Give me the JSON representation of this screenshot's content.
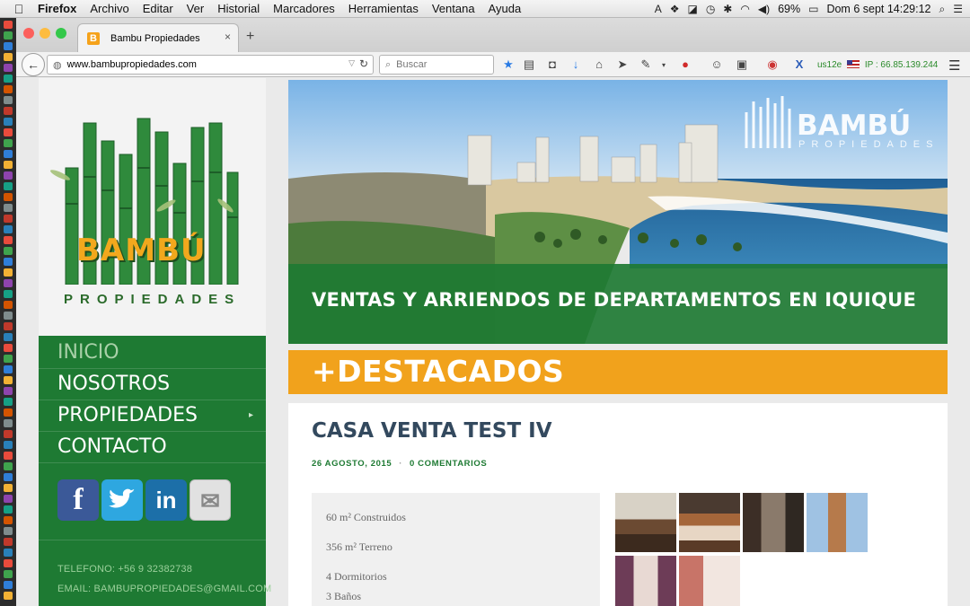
{
  "menubar": {
    "apple_icon": "apple-icon",
    "app": "Firefox",
    "items": [
      "Archivo",
      "Editar",
      "Ver",
      "Historial",
      "Marcadores",
      "Herramientas",
      "Ventana",
      "Ayuda"
    ],
    "battery": "69%",
    "datetime": "Dom 6 sept  14:29:12"
  },
  "browser": {
    "tab_title": "Bambu Propiedades",
    "tab_favicon": "B",
    "url": "www.bambupropiedades.com",
    "search_placeholder": "Buscar",
    "ext_user": "us12e",
    "ext_ip": "IP : 66.85.139.244"
  },
  "sidebar": {
    "logo_name": "BAMBÚ",
    "logo_sub": "PROPIEDADES",
    "nav": [
      {
        "label": "INICIO",
        "active": true
      },
      {
        "label": "NOSOTROS"
      },
      {
        "label": "PROPIEDADES",
        "has_submenu": true
      },
      {
        "label": "CONTACTO"
      }
    ],
    "social": [
      {
        "icon": "facebook-icon",
        "glyph": "f",
        "color": "#3b5998"
      },
      {
        "icon": "twitter-icon",
        "glyph": "t",
        "color": "#2ea7e0"
      },
      {
        "icon": "linkedin-icon",
        "glyph": "in",
        "color": "#1c6fa8"
      },
      {
        "icon": "mail-icon",
        "glyph": "✉",
        "color": "#d5d5d5"
      }
    ],
    "phone": "TELEFONO: +56 9 32382738",
    "email": "EMAIL: BAMBUPROPIEDADES@GMAIL.COM"
  },
  "banner": {
    "brand": "BAMBÚ",
    "brand_sub": "PROPIEDADES",
    "tagline": "VENTAS Y ARRIENDOS DE DEPARTAMENTOS EN IQUIQUE"
  },
  "featured": {
    "heading": "+DESTACADOS",
    "post": {
      "title": "CASA VENTA TEST IV",
      "date": "26 AGOSTO, 2015",
      "comments": "0 COMENTARIOS",
      "specs": [
        "60 m² Construidos",
        "356 m² Terreno",
        "4 Dormitorios",
        "3 Baños"
      ]
    }
  },
  "colors": {
    "brand_green": "#1e7a33",
    "brand_orange": "#f1a21c",
    "title_blue": "#33495e"
  }
}
